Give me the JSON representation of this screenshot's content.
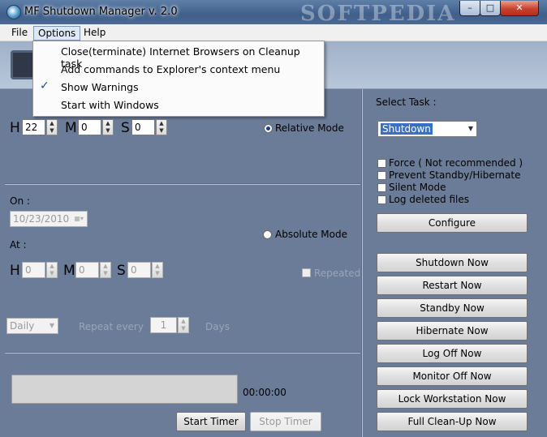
{
  "window": {
    "title": "MF Shutdown Manager v. 2.0",
    "watermark": "SOFTPEDIA",
    "min_glyph": "–",
    "max_glyph": "□",
    "close_glyph": "✕"
  },
  "menubar": {
    "file": "File",
    "options": "Options",
    "help": "Help"
  },
  "options_menu": {
    "items": [
      {
        "label": "Close(terminate) Internet Browsers on Cleanup task",
        "checked": false
      },
      {
        "label": "Add commands to Explorer's context menu",
        "checked": false
      },
      {
        "label": "Show Warnings",
        "checked": true
      },
      {
        "label": "Start with Windows",
        "checked": false
      }
    ],
    "check_glyph": "✓"
  },
  "relative": {
    "h_label": "H",
    "m_label": "M",
    "s_label": "S",
    "hours": "22",
    "minutes": "0",
    "seconds": "0",
    "mode_label": "Relative Mode"
  },
  "absolute": {
    "on_label": "On :",
    "date": "10/23/2010",
    "at_label": "At :",
    "mode_label": "Absolute Mode",
    "h_label": "H",
    "m_label": "M",
    "s_label": "S",
    "hours": "0",
    "minutes": "0",
    "seconds": "0",
    "repeated_label": "Repeated"
  },
  "repeat": {
    "frequency": "Daily",
    "every_label": "Repeat every",
    "count": "1",
    "unit_label": "Days"
  },
  "timer": {
    "elapsed": "00:00:00",
    "start_label": "Start Timer",
    "stop_label": "Stop Timer"
  },
  "task": {
    "select_label": "Select Task :",
    "selected": "Shutdown",
    "options": [
      {
        "label": "Force ( Not recommended )",
        "checked": false
      },
      {
        "label": "Prevent Standby/Hibernate",
        "checked": false
      },
      {
        "label": "Silent Mode",
        "checked": false
      },
      {
        "label": "Log deleted files",
        "checked": false
      }
    ],
    "configure_label": "Configure",
    "actions": [
      "Shutdown Now",
      "Restart Now",
      "Standby Now",
      "Hibernate Now",
      "Log Off Now",
      "Monitor Off Now",
      "Lock Workstation Now",
      "Full Clean-Up Now"
    ]
  }
}
